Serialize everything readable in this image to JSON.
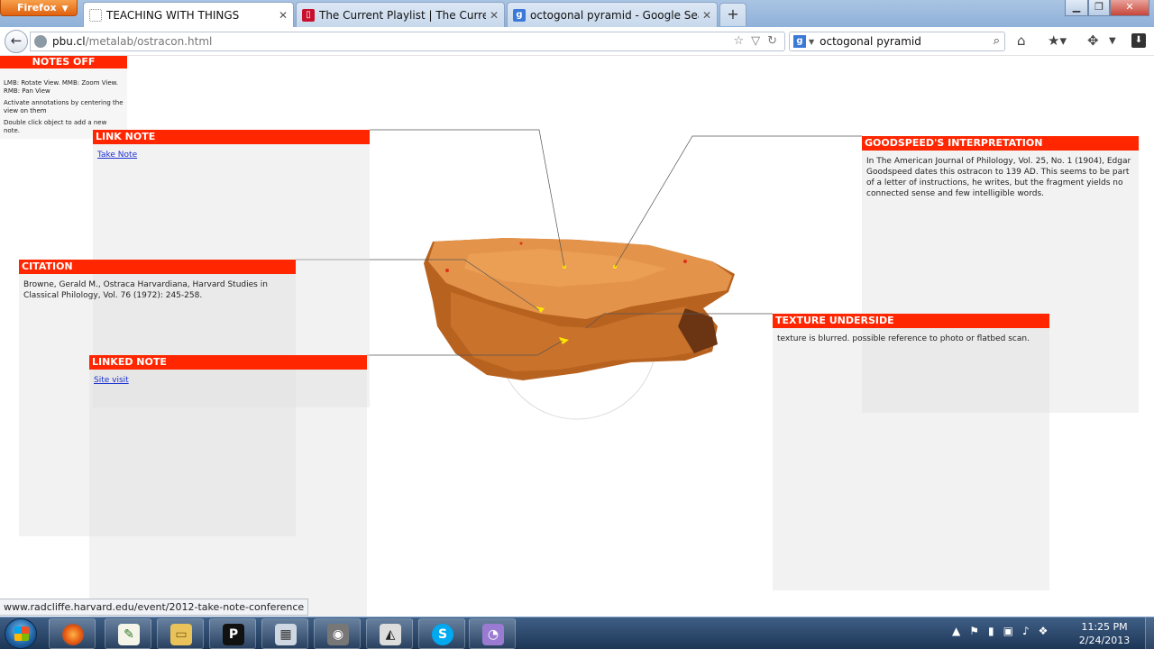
{
  "browser": {
    "menu_button": "Firefox",
    "tabs": [
      {
        "label": "TEACHING WITH THINGS",
        "active": true
      },
      {
        "label": "The Current Playlist | The Current fro...",
        "active": false
      },
      {
        "label": "octogonal pyramid - Google Search",
        "active": false
      }
    ],
    "url_host": "pbu.cl",
    "url_path": "/metalab/ostracon.html",
    "search_value": "octogonal pyramid",
    "status_text": "www.radcliffe.harvard.edu/event/2012-take-note-conference"
  },
  "page": {
    "notes_toggle": "NOTES OFF",
    "help": {
      "line1": "LMB: Rotate View. MMB: Zoom View. RMB: Pan View",
      "line2": "Activate annotations by centering the view on them",
      "line3": "Double click object to add a new note."
    },
    "notes": {
      "link_note": {
        "title": "LINK NOTE",
        "link": "Take Note"
      },
      "citation": {
        "title": "CITATION",
        "text": "Browne, Gerald M., Ostraca Harvardiana, Harvard Studies in Classical Philology, Vol. 76 (1972): 245-258."
      },
      "linked_note": {
        "title": "LINKED NOTE",
        "link": "Site visit"
      },
      "interpretation": {
        "title": "GOODSPEED'S INTERPRETATION",
        "text": "In The American Journal of Philology, Vol. 25, No. 1 (1904), Edgar Goodspeed dates this ostracon to 139 AD. This seems to be part of a letter of instructions, he writes, but the fragment yields no connected sense and few intelligible words."
      },
      "texture": {
        "title": "TEXTURE UNDERSIDE",
        "text": "texture is blurred. possible reference to photo or flatbed scan."
      }
    }
  },
  "taskbar": {
    "time": "11:25 PM",
    "date": "2/24/2013"
  },
  "colors": {
    "note_header": "#ff2600",
    "ostracon": "#d98a3f",
    "marker": "#ffe600"
  }
}
